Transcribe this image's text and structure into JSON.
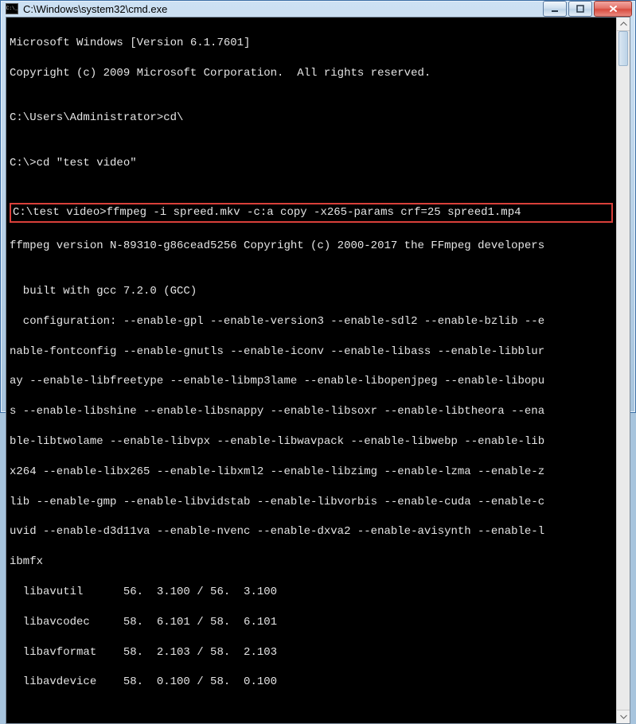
{
  "window": {
    "title": "C:\\Windows\\system32\\cmd.exe"
  },
  "controls": {
    "minimize": "minimize",
    "maximize": "maximize",
    "close": "close"
  },
  "console": {
    "line1": "Microsoft Windows [Version 6.1.7601]",
    "line2": "Copyright (c) 2009 Microsoft Corporation.  All rights reserved.",
    "blank1": "",
    "line3": "C:\\Users\\Administrator>cd\\",
    "blank2": "",
    "line4": "C:\\>cd \"test video\"",
    "blank3": "",
    "highlight": "C:\\test video>ffmpeg -i spreed.mkv -c:a copy -x265-params crf=25 spreed1.mp4",
    "line5": "ffmpeg version N-89310-g86cead5256 Copyright (c) 2000-2017 the FFmpeg developers",
    "blank4": "",
    "line6": "  built with gcc 7.2.0 (GCC)",
    "line7": "  configuration: --enable-gpl --enable-version3 --enable-sdl2 --enable-bzlib --e",
    "line8": "nable-fontconfig --enable-gnutls --enable-iconv --enable-libass --enable-libblur",
    "line9": "ay --enable-libfreetype --enable-libmp3lame --enable-libopenjpeg --enable-libopu",
    "line10": "s --enable-libshine --enable-libsnappy --enable-libsoxr --enable-libtheora --ena",
    "line11": "ble-libtwolame --enable-libvpx --enable-libwavpack --enable-libwebp --enable-lib",
    "line12": "x264 --enable-libx265 --enable-libxml2 --enable-libzimg --enable-lzma --enable-z",
    "line13": "lib --enable-gmp --enable-libvidstab --enable-libvorbis --enable-cuda --enable-c",
    "line14": "uvid --enable-d3d11va --enable-nvenc --enable-dxva2 --enable-avisynth --enable-l",
    "line15": "ibmfx",
    "line16": "  libavutil      56.  3.100 / 56.  3.100",
    "line17": "  libavcodec     58.  6.101 / 58.  6.101",
    "line18": "  libavformat    58.  2.103 / 58.  2.103",
    "line19": "  libavdevice    58.  0.100 / 58.  0.100"
  }
}
